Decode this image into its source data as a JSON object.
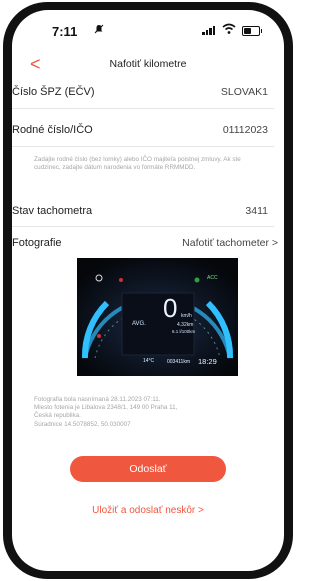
{
  "status_bar": {
    "time": "7:11",
    "battery_level": 0.55
  },
  "nav": {
    "back_glyph": "<",
    "title": "Nafotiť kilometre"
  },
  "plate": {
    "label": "Číslo ŠPZ (EČV)",
    "value": "SLOVAK1"
  },
  "birth": {
    "label": "Rodné číslo/IČO",
    "value": "01112023"
  },
  "hint_text": "Zadajte rodné číslo (bez lomky) alebo IČO majiteľa poistnej zmluvy. Ak ste cudzinec, zadajte dátum narodenia vo formáte RRMMDD.",
  "odometer": {
    "label": "Stav tachometra",
    "value": "3411"
  },
  "photos": {
    "label": "Fotografie",
    "action": "Nafotiť tachometer >"
  },
  "dashboard": {
    "speed": "0",
    "speed_unit": "km/h",
    "avg": "AVG.",
    "trip": "4.32km",
    "consumption": "6.1 l/100km",
    "temp": "14°C",
    "odometer_reading": "003411km",
    "clock": "18:29",
    "acc": "ACC"
  },
  "photo_info": [
    "Fotografia bola nasnímaná 28.11.2023 07:11.",
    "Miesto fotenia je  Libalova 2348/1, 149 00 Praha 11,",
    "Česká republika.",
    "Súradnice 14.5078852, 50.030007"
  ],
  "buttons": {
    "send": "Odoslať",
    "later": "Uložiť a odoslať neskôr >"
  },
  "colors": {
    "accent": "#f0573f",
    "hint": "#a6a6a6"
  }
}
